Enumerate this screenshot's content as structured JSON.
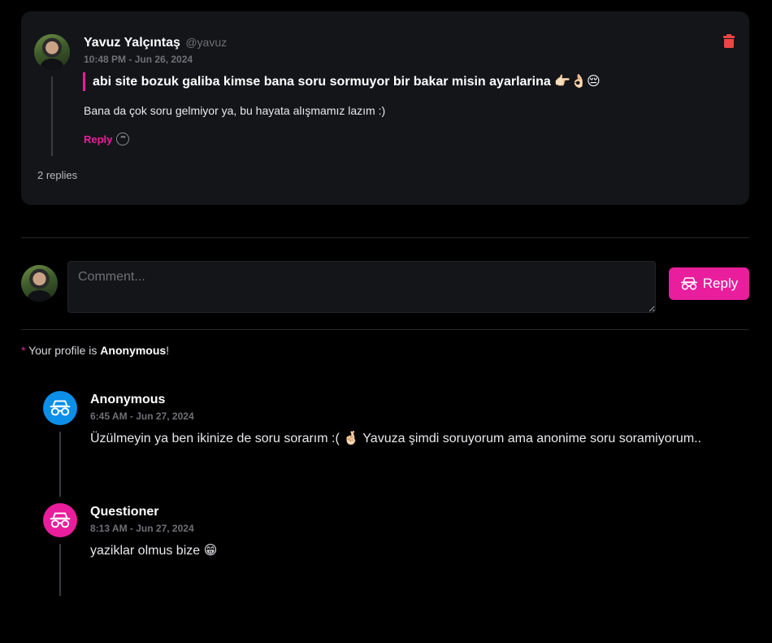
{
  "post": {
    "author_name": "Yavuz Yalçıntaş",
    "author_handle": "@yavuz",
    "timestamp": "10:48 PM - Jun 26, 2024",
    "quote": "abi site bozuk galiba kimse bana soru sormuyor bir bakar misin ayarlarina 👉🏻👌🏻😔",
    "body": "Bana da çok soru gelmiyor ya, bu hayata alışmamız lazım :)",
    "reply_label": "Reply",
    "replies_count": "2 replies",
    "icons": {
      "delete": "trash-icon",
      "comment": "chat-bubble-icon"
    }
  },
  "composer": {
    "placeholder": "Comment...",
    "button_label": "Reply",
    "button_icon": "incognito-icon"
  },
  "profile_note": {
    "star": "*",
    "prefix": "Your profile is",
    "status": "Anonymous",
    "suffix": "!"
  },
  "replies": [
    {
      "name": "Anonymous",
      "timestamp": "6:45 AM - Jun 27, 2024",
      "text": "Üzülmeyin ya ben ikinize de soru sorarım :( 🤞🏻 Yavuza şimdi soruyorum ama anonime soru soramiyorum..",
      "avatar_color": "#0b8fe8",
      "avatar_icon": "incognito-icon"
    },
    {
      "name": "Questioner",
      "timestamp": "8:13 AM - Jun 27, 2024",
      "text": "yaziklar olmus bize 😁",
      "avatar_color": "#e91e9c",
      "avatar_icon": "incognito-icon"
    }
  ],
  "colors": {
    "accent": "#e91e9c",
    "danger": "#ef4444",
    "card_bg": "#141519",
    "page_bg": "#000000"
  }
}
